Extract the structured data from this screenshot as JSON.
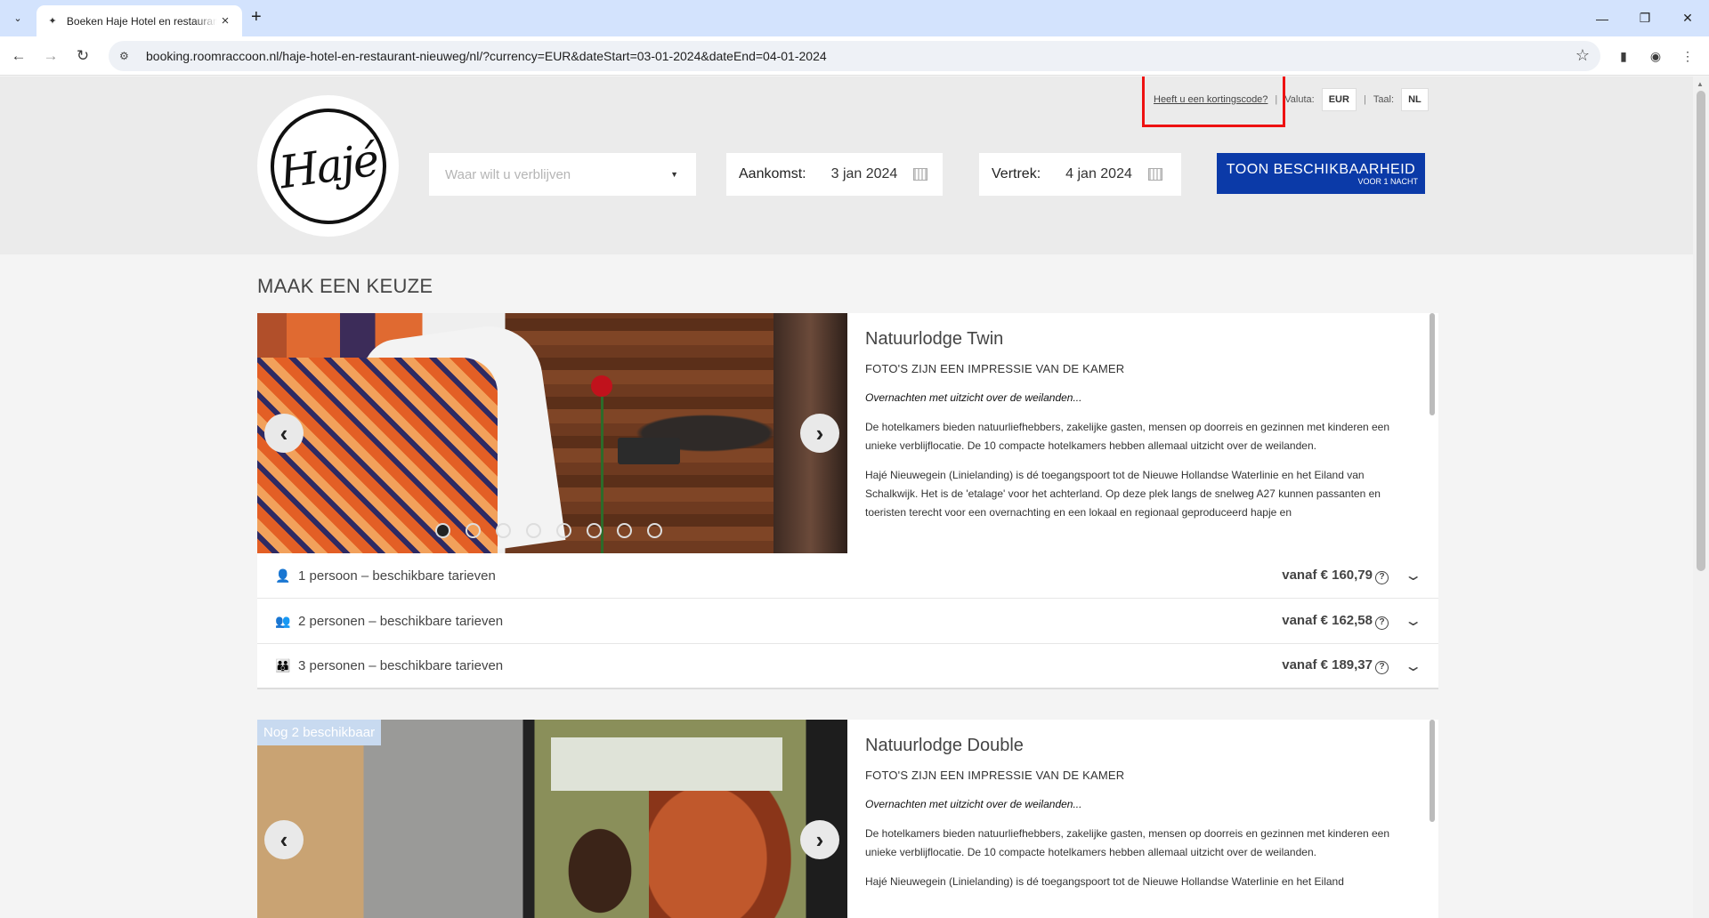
{
  "browser": {
    "tab_title": "Boeken Haje Hotel en restaurant",
    "url": "booking.roomraccoon.nl/haje-hotel-en-restaurant-nieuweg/nl/?currency=EUR&dateStart=03-01-2024&dateEnd=04-01-2024"
  },
  "header": {
    "logo_text": "Hajé",
    "promo_link": "Heeft u een kortingscode?",
    "currency_label": "Valuta:",
    "currency_value": "EUR",
    "separator": "|",
    "language_label": "Taal:",
    "language_value": "NL",
    "destination_placeholder": "Waar wilt u verblijven",
    "arrival_label": "Aankomst:",
    "arrival_value": "3 jan 2024",
    "departure_label": "Vertrek:",
    "departure_value": "4 jan 2024",
    "cta_label": "TOON BESCHIKBAARHEID",
    "cta_sub": "VOOR 1 NACHT"
  },
  "section_title": "MAAK EEN KEUZE",
  "rooms": [
    {
      "name": "Natuurlodge Twin",
      "note": "FOTO'S ZIJN EEN IMPRESSIE VAN DE KAMER",
      "tagline": "Overnachten met uitzicht over de weilanden...",
      "desc1": "De hotelkamers bieden natuurliefhebbers, zakelijke gasten, mensen op doorreis en gezinnen met kinderen een unieke verblijflocatie. De 10 compacte hotelkamers hebben allemaal uitzicht over de weilanden.",
      "desc2": "Hajé Nieuwegein (Linielanding) is dé toegangspoort tot de Nieuwe Hollandse Waterlinie en het Eiland van Schalkwijk. Het is de 'etalage' voor het achterland. Op deze plek langs de snelweg A27 kunnen passanten en toeristen terecht voor een overnachting en een lokaal en regionaal geproduceerd hapje en",
      "rates": [
        {
          "label": "1 persoon – beschikbare tarieven",
          "price": "vanaf € 160,79"
        },
        {
          "label": "2 personen – beschikbare tarieven",
          "price": "vanaf € 162,58"
        },
        {
          "label": "3 personen – beschikbare tarieven",
          "price": "vanaf € 189,37"
        }
      ]
    },
    {
      "badge": "Nog 2 beschikbaar",
      "name": "Natuurlodge Double",
      "note": "FOTO'S ZIJN EEN IMPRESSIE VAN DE KAMER",
      "tagline": "Overnachten met uitzicht over de weilanden...",
      "desc1": "De hotelkamers bieden natuurliefhebbers, zakelijke gasten, mensen op doorreis en gezinnen met kinderen een unieke verblijflocatie. De 10 compacte hotelkamers hebben allemaal uitzicht over de weilanden.",
      "desc2": "Hajé Nieuwegein (Linielanding) is dé toegangspoort tot de Nieuwe Hollandse Waterlinie en het Eiland"
    }
  ],
  "colors": {
    "cta": "#0b3aa8",
    "highlight": "#ee1111"
  }
}
